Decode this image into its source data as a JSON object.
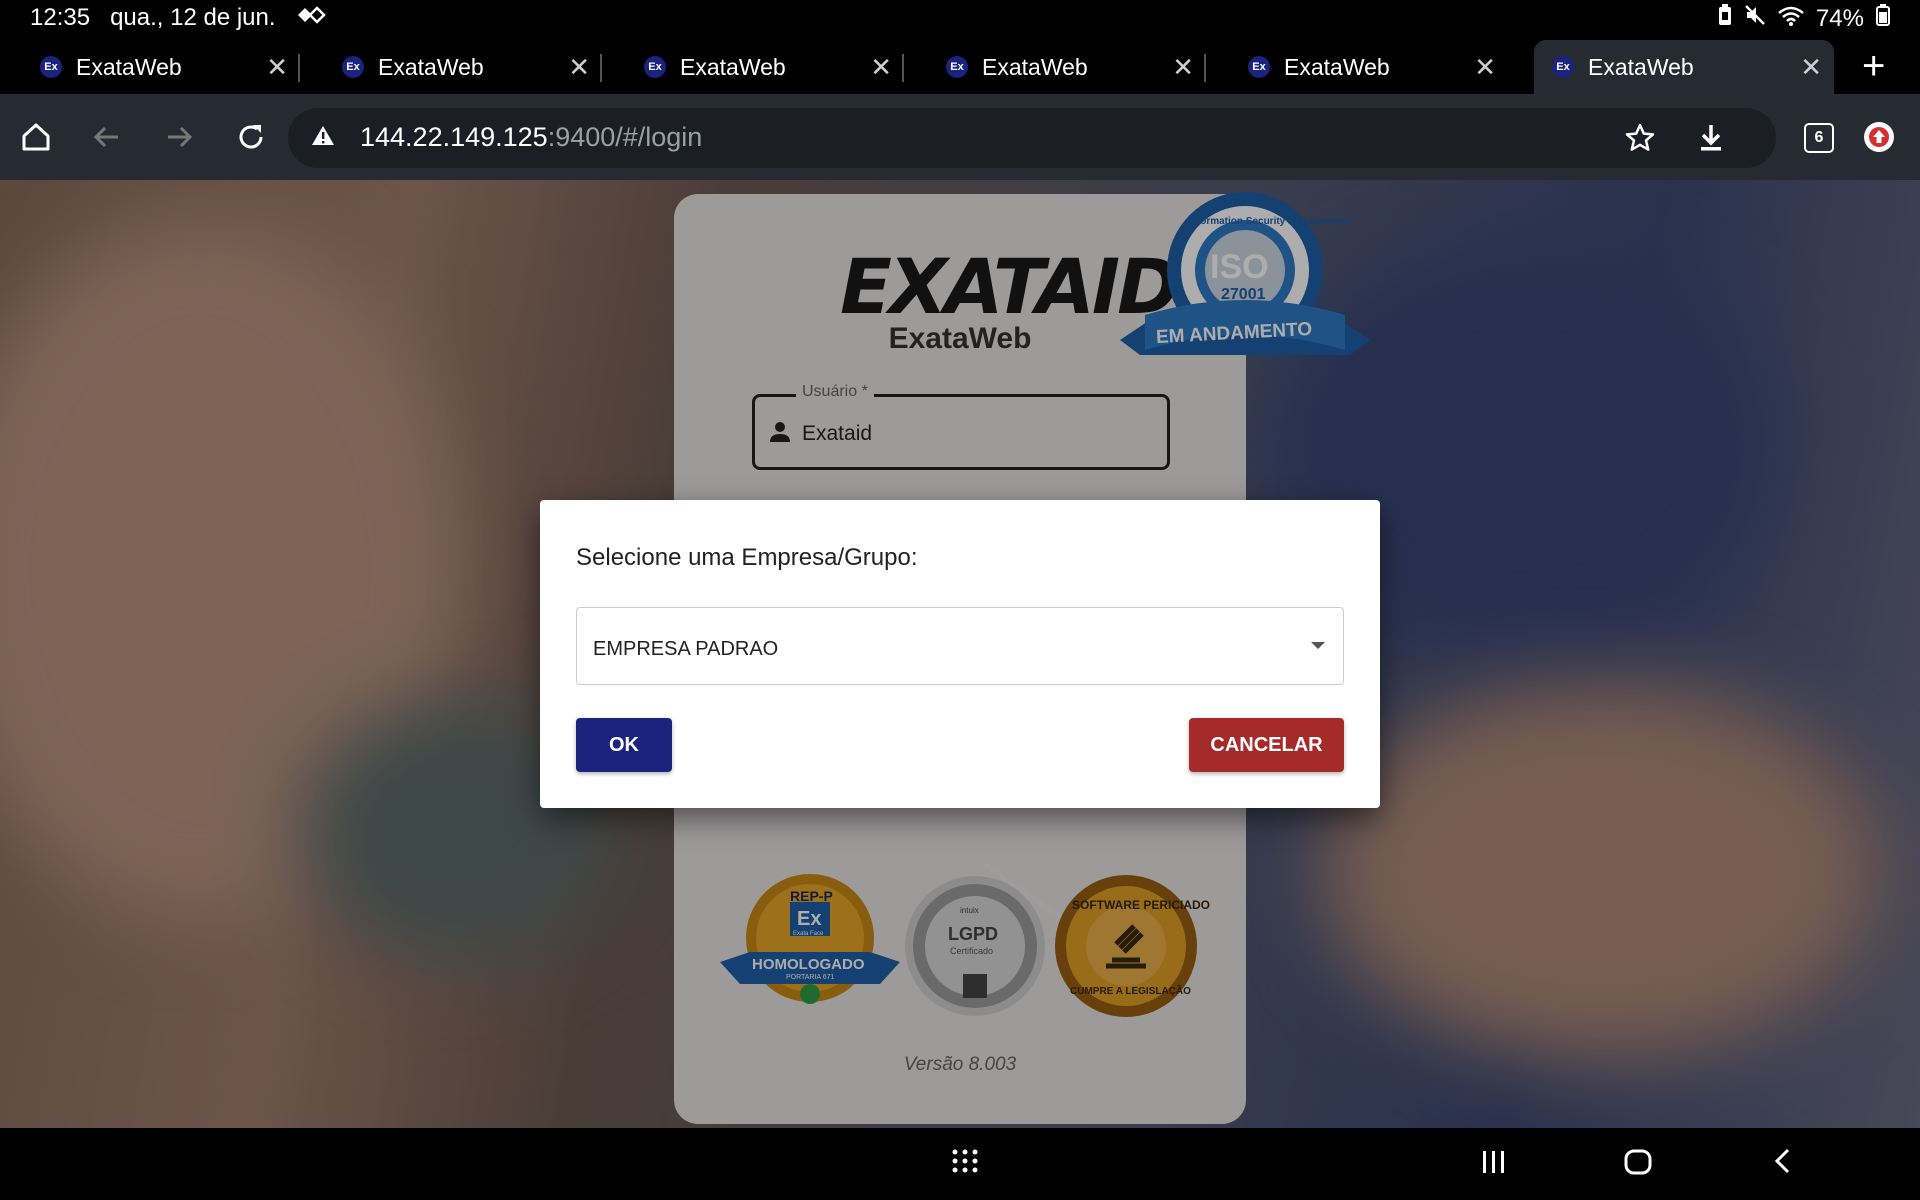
{
  "status_bar": {
    "time": "12:35",
    "date": "qua., 12 de jun.",
    "battery": "74%"
  },
  "tabs": [
    {
      "favicon": "Ex",
      "title": "ExataWeb"
    },
    {
      "favicon": "Ex",
      "title": "ExataWeb"
    },
    {
      "favicon": "Ex",
      "title": "ExataWeb"
    },
    {
      "favicon": "Ex",
      "title": "ExataWeb"
    },
    {
      "favicon": "Ex",
      "title": "ExataWeb"
    },
    {
      "favicon": "Ex",
      "title": "ExataWeb"
    }
  ],
  "toolbar": {
    "url_host": "144.22.149.125",
    "url_rest": ":9400/#/login",
    "tab_count": "6"
  },
  "login": {
    "logo": "EXATAID",
    "app_name": "ExataWeb",
    "user_label": "Usuário *",
    "user_value": "Exataid",
    "version": "Versão 8.003"
  },
  "badges": {
    "iso_top": "Information Security Management",
    "iso_main": "ISO",
    "iso_num": "27001",
    "iso_ribbon": "EM ANDAMENTO",
    "rep_top": "REP-P",
    "rep_logo": "Ex",
    "rep_sub": "Exata Face",
    "rep_ribbon": "HOMOLOGADO",
    "rep_portaria": "PORTARIA 671",
    "lgpd_brand": "intuix",
    "lgpd_main": "LGPD",
    "lgpd_sub": "Certificado",
    "lgpd_ring": "LEI GERAL DE PROTEÇÃO DE DADOS",
    "soft_top": "SOFTWARE PERICIADO",
    "soft_bottom": "CUMPRE A LEGISLAÇÃO"
  },
  "dialog": {
    "title": "Selecione uma Empresa/Grupo:",
    "selected": "EMPRESA PADRAO",
    "ok_label": "OK",
    "cancel_label": "CANCELAR"
  },
  "colors": {
    "primary": "#1a237e",
    "danger": "#a52a2a",
    "toolbar": "#262b33"
  }
}
